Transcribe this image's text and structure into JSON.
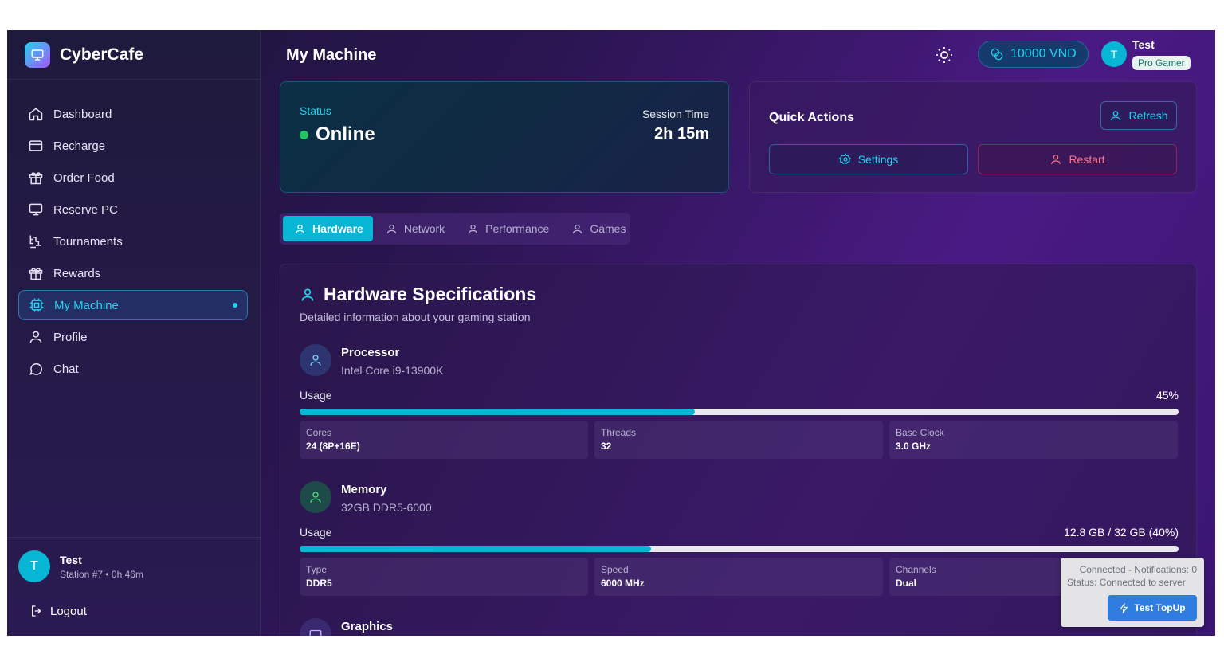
{
  "brand": {
    "name": "CyberCafe",
    "logo_icon": "monitor-icon"
  },
  "sidebar": {
    "items": [
      {
        "label": "Dashboard",
        "icon": "home-icon"
      },
      {
        "label": "Recharge",
        "icon": "credit-card-icon"
      },
      {
        "label": "Order Food",
        "icon": "gift-icon"
      },
      {
        "label": "Reserve PC",
        "icon": "monitor-icon"
      },
      {
        "label": "Tournaments",
        "icon": "tournament-icon"
      },
      {
        "label": "Rewards",
        "icon": "gift-icon"
      },
      {
        "label": "My Machine",
        "icon": "cpu-icon",
        "active": true
      },
      {
        "label": "Profile",
        "icon": "user-icon"
      },
      {
        "label": "Chat",
        "icon": "chat-icon"
      }
    ],
    "user": {
      "initial": "T",
      "name": "Test",
      "sub": "Station #7 • 0h 46m"
    },
    "logout_label": "Logout"
  },
  "header": {
    "title": "My Machine",
    "balance": "10000 VND",
    "user_initial": "T",
    "user_name": "Test",
    "user_badge": "Pro Gamer"
  },
  "status": {
    "label": "Status",
    "value": "Online",
    "session_label": "Session Time",
    "session_value": "2h 15m"
  },
  "quick_actions": {
    "title": "Quick Actions",
    "refresh": "Refresh",
    "settings": "Settings",
    "restart": "Restart"
  },
  "tabs": [
    {
      "label": "Hardware",
      "active": true
    },
    {
      "label": "Network"
    },
    {
      "label": "Performance"
    },
    {
      "label": "Games"
    }
  ],
  "hardware": {
    "title": "Hardware Specifications",
    "subtitle": "Detailed information about your gaming station",
    "components": [
      {
        "name": "Processor",
        "model": "Intel Core i9-13900K",
        "usage_label": "Usage",
        "usage_value": "45%",
        "usage_fraction": 0.45,
        "specs": [
          {
            "k": "Cores",
            "v": "24 (8P+16E)"
          },
          {
            "k": "Threads",
            "v": "32"
          },
          {
            "k": "Base Clock",
            "v": "3.0 GHz"
          }
        ]
      },
      {
        "name": "Memory",
        "model": "32GB DDR5-6000",
        "usage_label": "Usage",
        "usage_value": "12.8 GB / 32 GB (40%)",
        "usage_fraction": 0.4,
        "specs": [
          {
            "k": "Type",
            "v": "DDR5"
          },
          {
            "k": "Speed",
            "v": "6000 MHz"
          },
          {
            "k": "Channels",
            "v": "Dual"
          }
        ]
      },
      {
        "name": "Graphics"
      }
    ]
  },
  "toast": {
    "line1": "Connected - Notifications: 0",
    "line2": "Status: Connected to server",
    "button": "Test TopUp"
  },
  "colors": {
    "accent": "#06b6d4",
    "online": "#22c55e",
    "danger": "#fb7185"
  }
}
